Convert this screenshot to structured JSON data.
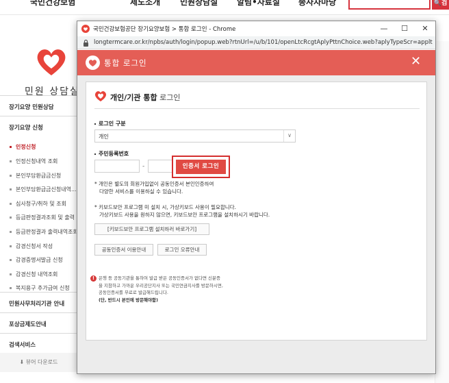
{
  "background": {
    "nav_items": [
      "국민건강보험",
      "제도소개",
      "민원상담실",
      "알림•자료실",
      "종사자마당"
    ],
    "search_button": "검",
    "sidebar_title": "민원 상담실",
    "sections": [
      {
        "label": "장기요양 민원상담"
      },
      {
        "label": "장기요양 신청"
      }
    ],
    "sub_items": [
      {
        "label": "인정신청",
        "active": true
      },
      {
        "label": "인정신청내역 조회"
      },
      {
        "label": "본인부담환급금신청"
      },
      {
        "label": "본인부담환급금신청내역..."
      },
      {
        "label": "심사청구/취하 및 조회"
      },
      {
        "label": "등급판정결과조회 및 출력"
      },
      {
        "label": "등급판정결과 출력내역조회"
      },
      {
        "label": "감경신청서 작성"
      },
      {
        "label": "감경증명서발급 신청"
      },
      {
        "label": "감경신청 내역조회"
      },
      {
        "label": "복지용구 추가급여 신청"
      }
    ],
    "bottom_sections": [
      "민원사무처리기관 안내",
      "포상금제도안내",
      "검색서비스"
    ],
    "viewer_download": "뷰어 다운로드"
  },
  "window": {
    "title": "국민건강보험공단 장기요양보험 > 통합 로그인 - Chrome",
    "minimize": "—",
    "maximize": "☐",
    "close": "✕",
    "url": "longtermcare.or.kr/npbs/auth/login/popup.web?rtnUrl=/u/b/101/openLtcRcgtAplyPttnChoice.web?aplyTypeScr=appltit"
  },
  "popup": {
    "header_title": "통합 로그인",
    "close_icon": "✕",
    "card_title_bold": "개인/기관 통합",
    "card_title_rest": "로그인",
    "login_type_label": "로그인 구분",
    "login_type_value": "개인",
    "rrn_label": "주민등록번호",
    "rrn_dash": "-",
    "cert_login_button": "인증서 로그인",
    "note1_line1": "* 개인은 별도의 회원가입없이 공동인증서 본인인증하여",
    "note1_line2": "다양한 서비스를 이용하실 수 있습니다.",
    "note2_line1": "* 키보드보안 프로그램 미 설치 시, 가상키보드 사용이 필요합니다.",
    "note2_line2": "가상키보드 사용을 원하지 않으면, 키보드보안 프로그램을 설치하시기 바랍니다.",
    "install_button": "[키보드보안 프로그램 설치하러 바로가기]",
    "cert_guide_button": "공동인증서 이용안내",
    "login_error_button": "로그인 오류안내",
    "warn_icon": "!",
    "warn_line1": "은행 등 공동기관을 통하여 발급 받은 공동인증서가 없다면 신분증",
    "warn_line2": "을 지참하고 가까운 우리공단지사 또는 국민연금지사를 방문하시면,",
    "warn_line3": "공동인증서를 무료로 발급해드립니다.",
    "warn_line4": "(단, 반드시 본인에 방문해야함)"
  },
  "colors": {
    "brand_red": "#e45e56",
    "accent_red": "#d42d2d"
  }
}
